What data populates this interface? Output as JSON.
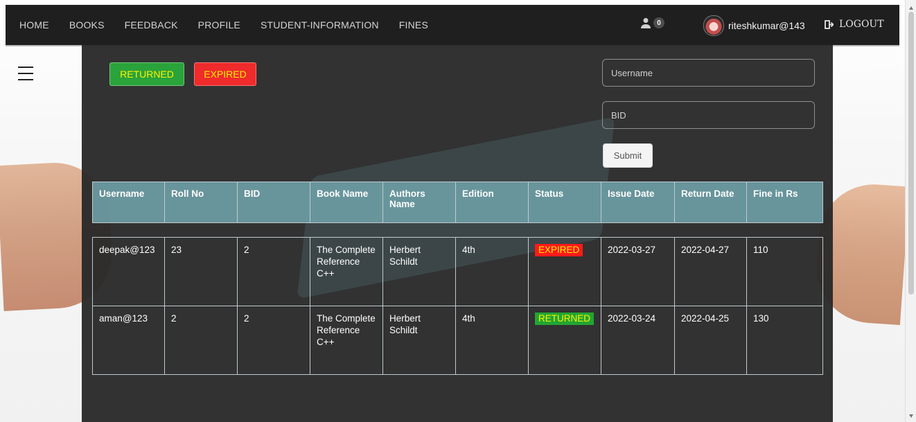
{
  "nav": {
    "items": [
      "HOME",
      "BOOKS",
      "FEEDBACK",
      "PROFILE",
      "STUDENT-INFORMATION",
      "FINES"
    ],
    "notification_count": "0",
    "username": "riteshkumar@143",
    "logout": "LOGOUT"
  },
  "actions": {
    "returned": "RETURNED",
    "expired": "EXPIRED",
    "submit": "Submit"
  },
  "fields": {
    "username_placeholder": "Username",
    "bid_placeholder": "BID"
  },
  "table": {
    "headers": [
      "Username",
      "Roll No",
      "BID",
      "Book Name",
      "Authors Name",
      "Edition",
      "Status",
      "Issue Date",
      "Return Date",
      "Fine in Rs"
    ],
    "rows": [
      {
        "username": "deepak@123",
        "roll_no": "23",
        "bid": "2",
        "book_name": "The Complete Reference C++",
        "authors_name": "Herbert Schildt",
        "edition": "4th",
        "status": "EXPIRED",
        "issue_date": "2022-03-27",
        "return_date": "2022-04-27",
        "fine": "110"
      },
      {
        "username": "aman@123",
        "roll_no": "2",
        "bid": "2",
        "book_name": "The Complete Reference C++",
        "authors_name": "Herbert Schildt",
        "edition": "4th",
        "status": "RETURNED",
        "issue_date": "2022-03-24",
        "return_date": "2022-04-25",
        "fine": "130"
      }
    ]
  },
  "icons": {
    "menu": "hamburger-menu-icon",
    "user": "user-icon",
    "logout": "logout-icon"
  },
  "colors": {
    "expired": "#ff1a1a",
    "returned": "#22a632",
    "status_text": "#fff100",
    "header": "#6c9ca4"
  }
}
